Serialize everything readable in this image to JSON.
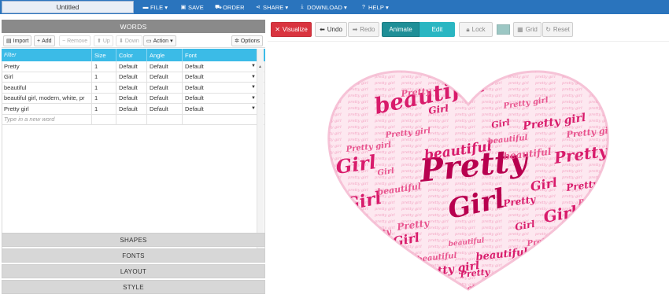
{
  "topbar": {
    "document_title": "Untitled",
    "menus": [
      {
        "label": "FILE",
        "icon": "file-icon",
        "glyph": "▬",
        "caret": "▾"
      },
      {
        "label": "SAVE",
        "icon": "save-icon",
        "glyph": "▣",
        "caret": ""
      },
      {
        "label": "ORDER",
        "icon": "cart-icon",
        "glyph": "⛟",
        "caret": ""
      },
      {
        "label": "SHARE",
        "icon": "share-icon",
        "glyph": "⋖",
        "caret": "▾"
      },
      {
        "label": "DOWNLOAD",
        "icon": "download-icon",
        "glyph": "⤓",
        "caret": "▾"
      },
      {
        "label": "HELP",
        "icon": "help-icon",
        "glyph": "?",
        "caret": "▾"
      }
    ]
  },
  "words_panel": {
    "title": "WORDS",
    "toolbar": {
      "import": "Import",
      "add": "Add",
      "remove": "Remove",
      "up": "Up",
      "down": "Down",
      "action": "Action",
      "options": "Options"
    },
    "columns": {
      "filter": "Filter",
      "size": "Size",
      "color": "Color",
      "angle": "Angle",
      "font": "Font"
    },
    "rows": [
      {
        "word": "Pretty",
        "size": "1",
        "color": "Default",
        "angle": "Default",
        "font": "Default"
      },
      {
        "word": "Girl",
        "size": "1",
        "color": "Default",
        "angle": "Default",
        "font": "Default"
      },
      {
        "word": "beautiful",
        "size": "1",
        "color": "Default",
        "angle": "Default",
        "font": "Default"
      },
      {
        "word": "beautiful girl, modern, white, pr",
        "size": "1",
        "color": "Default",
        "angle": "Default",
        "font": "Default"
      },
      {
        "word": "Pretty girl",
        "size": "1",
        "color": "Default",
        "angle": "Default",
        "font": "Default"
      }
    ],
    "new_word_placeholder": "Type in a new word"
  },
  "accordion": {
    "shapes": "SHAPES",
    "fonts": "FONTS",
    "layout": "LAYOUT",
    "style": "STYLE"
  },
  "canvas_toolbar": {
    "visualize": "Visualize",
    "undo": "Undo",
    "redo": "Redo",
    "animate": "Animate",
    "edit": "Edit",
    "lock": "Lock",
    "grid": "Grid",
    "reset": "Reset",
    "swatch_color": "#9cc7c4"
  },
  "word_cloud": {
    "shape": "heart",
    "colors": {
      "dark": "#b8004f",
      "mid": "#d81b6b",
      "light": "#e8558f",
      "pale": "#f3a3c2"
    },
    "words": {
      "pretty": "Pretty",
      "girl": "Girl",
      "beautiful": "beautiful",
      "pretty_girl": "Pretty girl"
    }
  }
}
